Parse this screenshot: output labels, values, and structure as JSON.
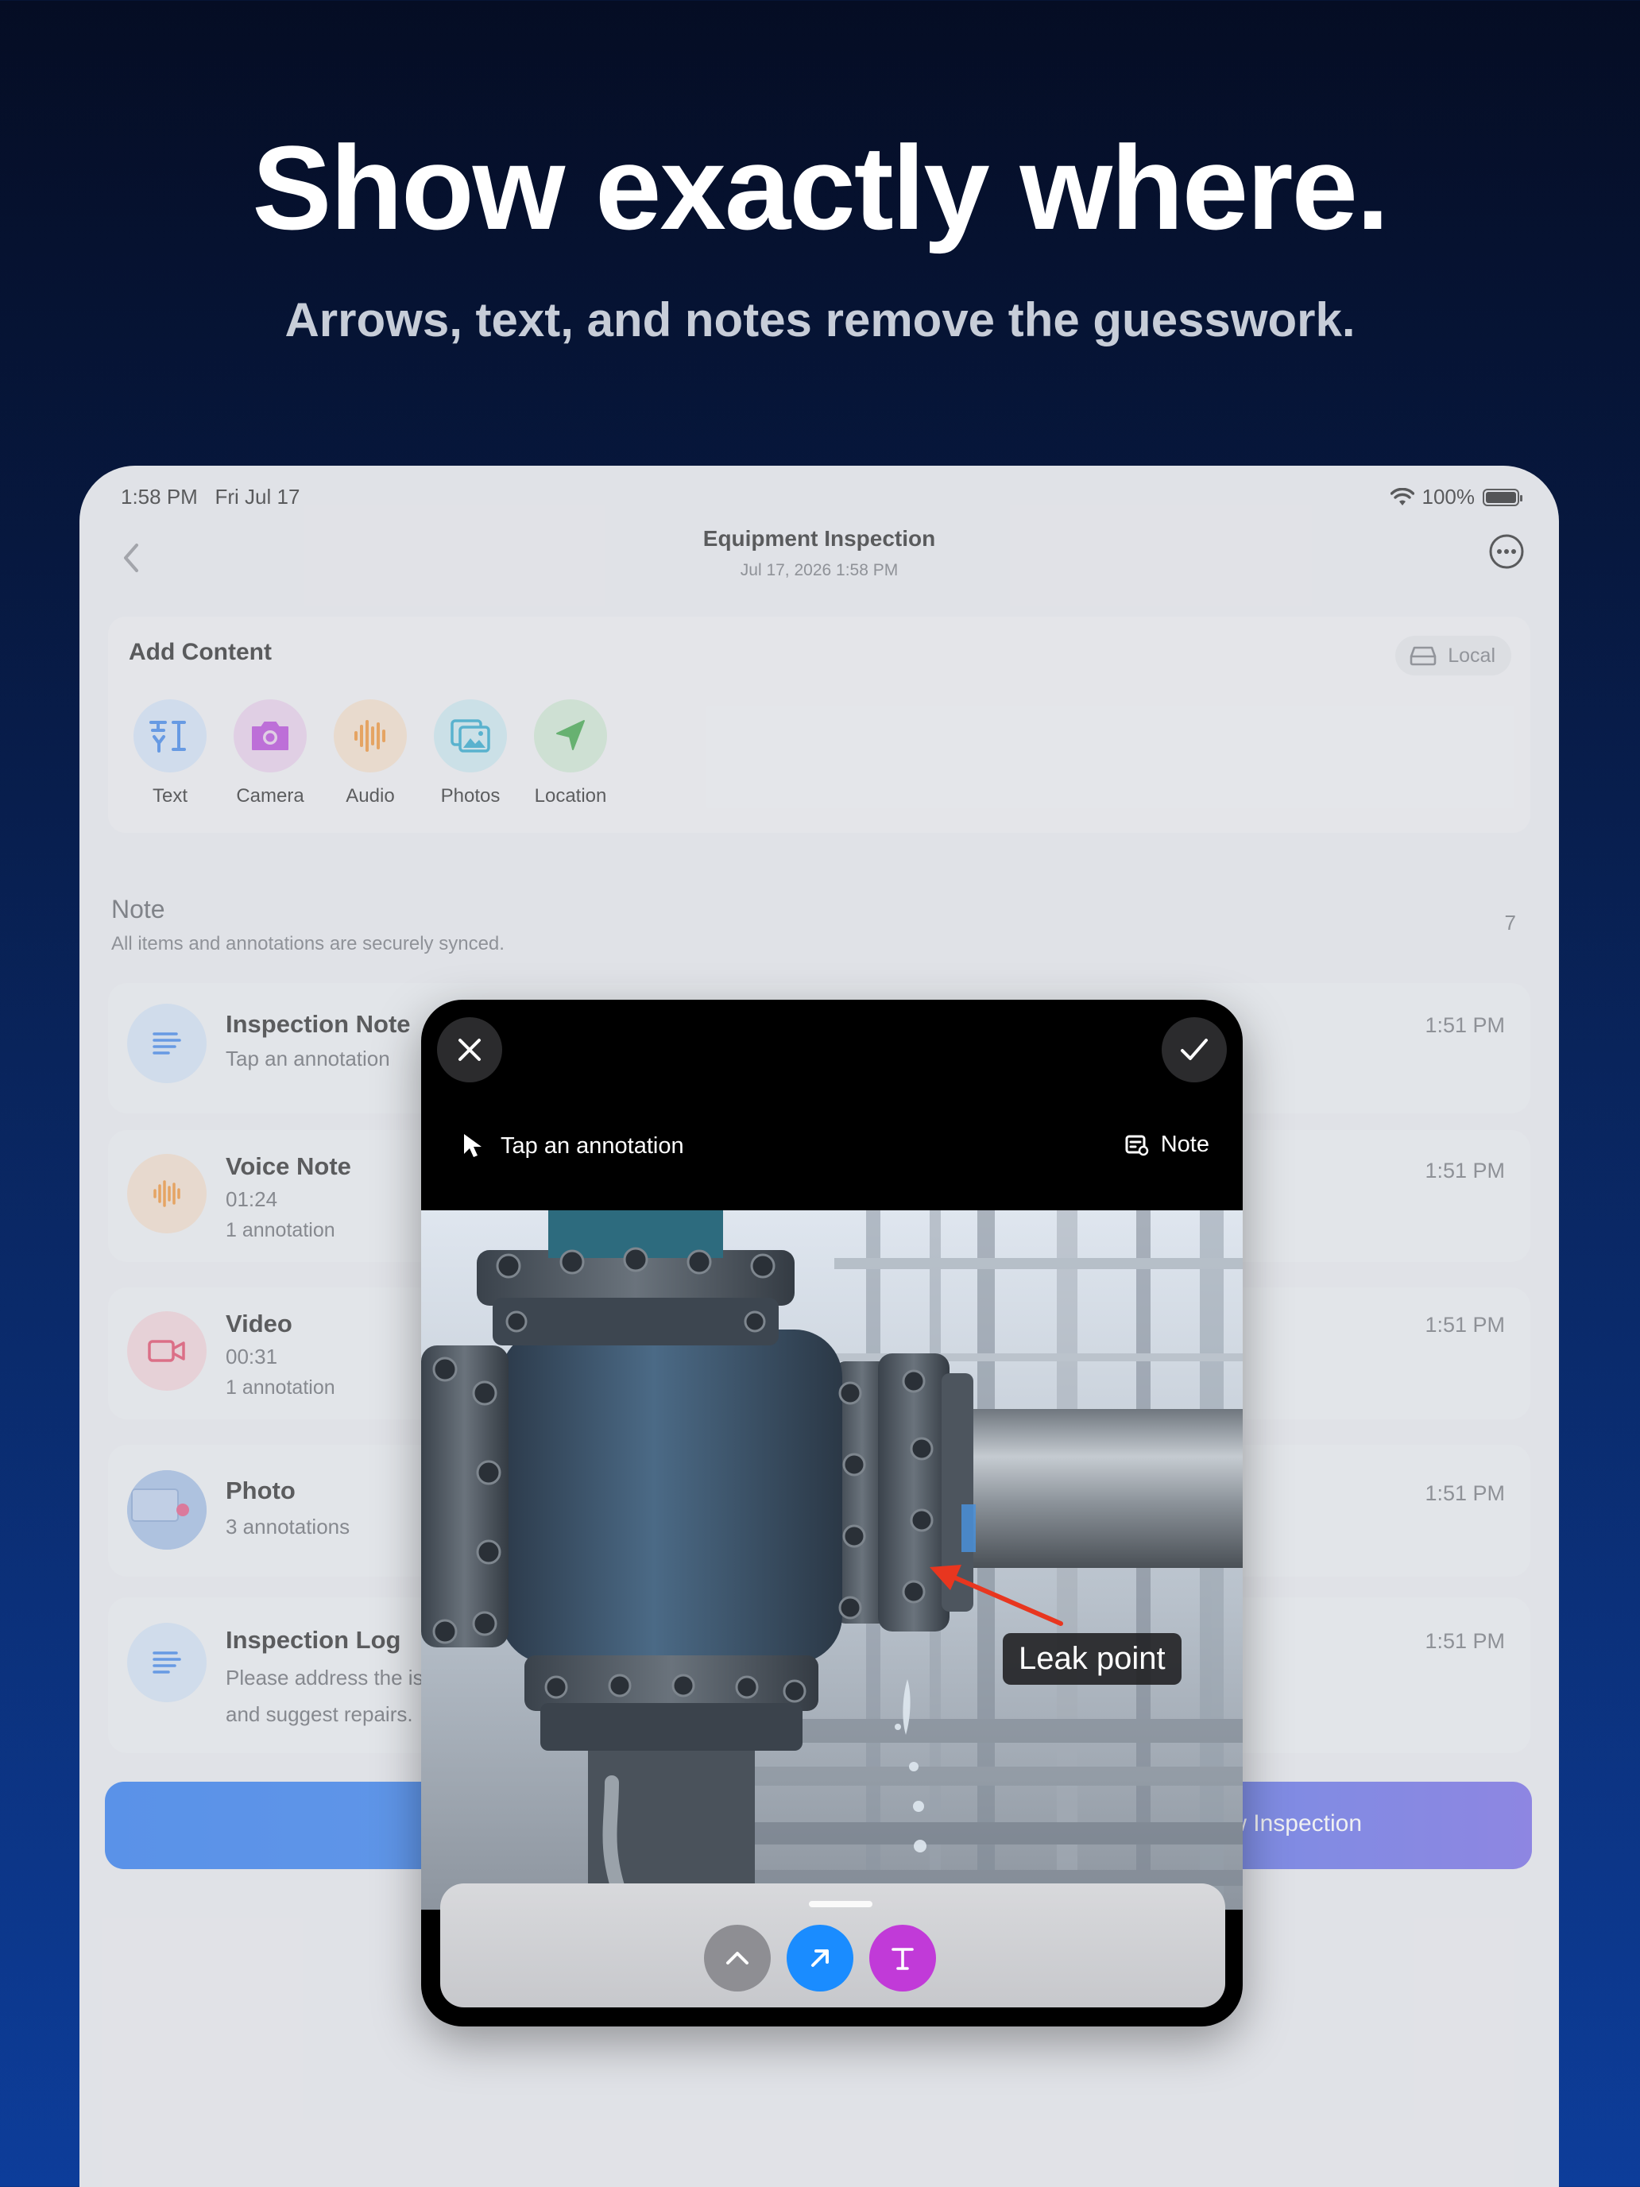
{
  "hero": {
    "title": "Show exactly where.",
    "subtitle": "Arrows, text, and notes remove the guesswork."
  },
  "status_bar": {
    "time": "1:58 PM",
    "date": "Fri Jul 17",
    "battery": "100%"
  },
  "nav": {
    "title": "Equipment Inspection",
    "subtitle": "Jul 17, 2026 1:58 PM"
  },
  "add_content": {
    "title": "Add Content",
    "storage_badge": "Local",
    "tools": [
      {
        "label": "Text",
        "icon": "text-cursor-icon",
        "color": "#2f7ce8"
      },
      {
        "label": "Camera",
        "icon": "camera-icon",
        "color": "#b23ad8"
      },
      {
        "label": "Audio",
        "icon": "waveform-icon",
        "color": "#f08a24"
      },
      {
        "label": "Photos",
        "icon": "photos-icon",
        "color": "#1aa0c8"
      },
      {
        "label": "Location",
        "icon": "location-arrow-icon",
        "color": "#2f9f3a"
      }
    ]
  },
  "note_section": {
    "title": "Note",
    "subtitle": "All items and annotations are securely synced.",
    "count": "7",
    "items": [
      {
        "title": "Inspection Note",
        "line1": "Tap an annotation",
        "line2": "",
        "time": "1:51 PM",
        "icon": "text-lines-icon"
      },
      {
        "title": "Voice Note",
        "line1": "01:24",
        "line2": "1 annotation",
        "time": "1:51 PM",
        "icon": "waveform-icon"
      },
      {
        "title": "Video",
        "line1": "00:31",
        "line2": "1 annotation",
        "time": "1:51 PM",
        "icon": "video-camera-icon"
      },
      {
        "title": "Photo",
        "line1": "3 annotations",
        "line2": "",
        "time": "1:51 PM",
        "icon": "photo-thumbnail-icon"
      },
      {
        "title": "Inspection Log",
        "line1": "Please address the is",
        "line2": "and suggest repairs.",
        "time": "1:51 PM",
        "icon": "text-lines-icon"
      }
    ]
  },
  "primary_button": {
    "label": "New Inspection"
  },
  "editor": {
    "hint": "Tap an annotation",
    "note_label": "Note",
    "annotation_text": "Leak point",
    "tools": [
      {
        "name": "collapse",
        "icon": "chevron-up-icon",
        "color": "#8e8e93"
      },
      {
        "name": "arrow",
        "icon": "arrow-tool-icon",
        "color": "#1a8cff"
      },
      {
        "name": "text",
        "icon": "text-tool-icon",
        "color": "#c13ad8"
      }
    ]
  },
  "colors": {
    "background_top": "#050d24",
    "background_bottom": "#0d3d9a",
    "accent_blue": "#1b6ff0",
    "accent_purple": "#6a5de6",
    "annotation_red": "#e8361f"
  }
}
